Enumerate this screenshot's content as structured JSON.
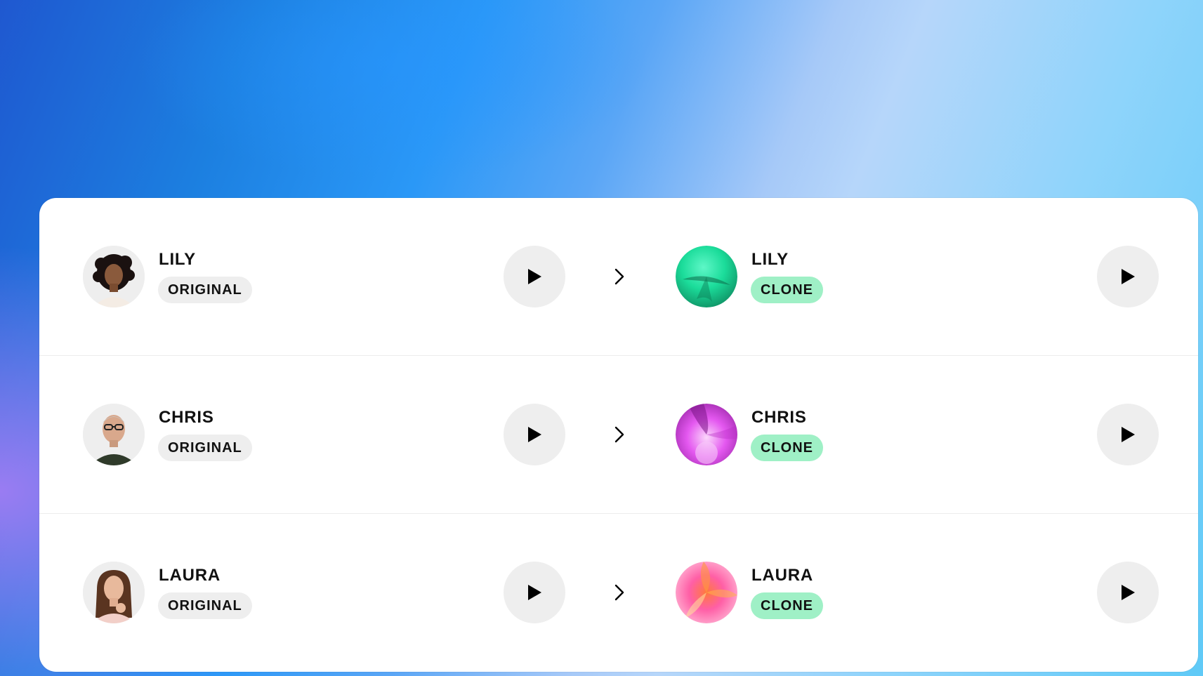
{
  "rows": [
    {
      "original": {
        "name": "LILY",
        "badge": "ORIGINAL"
      },
      "clone": {
        "name": "LILY",
        "badge": "CLONE",
        "orb_colors": [
          "#1bdc9a",
          "#0f8f63",
          "#37f1b8"
        ]
      }
    },
    {
      "original": {
        "name": "CHRIS",
        "badge": "ORIGINAL"
      },
      "clone": {
        "name": "CHRIS",
        "badge": "CLONE",
        "orb_colors": [
          "#e458f0",
          "#8d1d9a",
          "#f6b8f8"
        ]
      }
    },
    {
      "original": {
        "name": "LAURA",
        "badge": "ORIGINAL"
      },
      "clone": {
        "name": "LAURA",
        "badge": "CLONE",
        "orb_colors": [
          "#ff5fa6",
          "#ff9a3c",
          "#ffd6e7"
        ]
      }
    }
  ],
  "icons": {
    "play": "play-icon",
    "arrow": "chevron-right-icon"
  },
  "colors": {
    "card_bg": "#ffffff",
    "play_bg": "#eeeeee",
    "original_badge_bg": "#eeeeee",
    "clone_badge_bg": "#9ff0c6"
  }
}
